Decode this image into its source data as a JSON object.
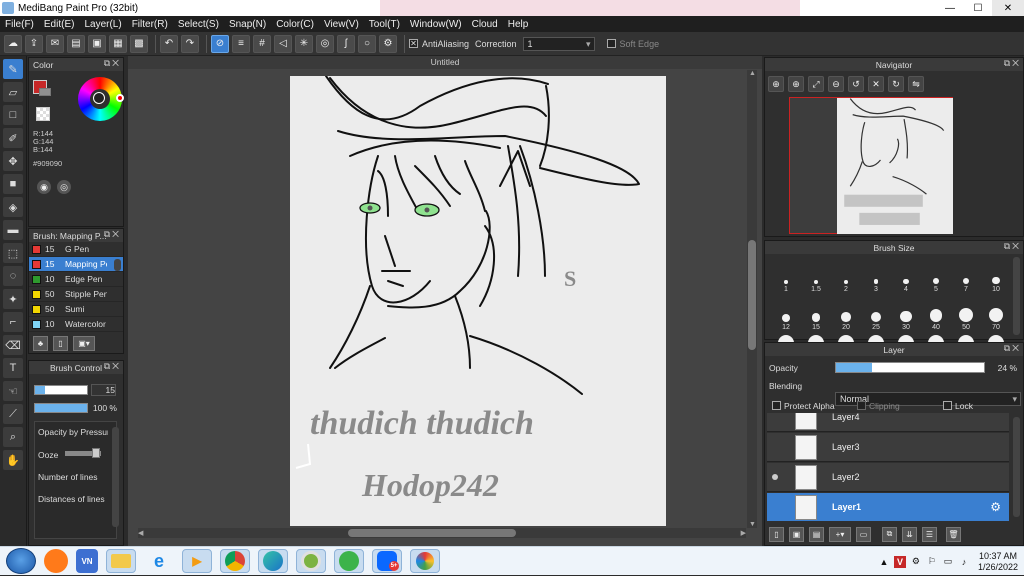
{
  "window": {
    "title": "MediBang Paint Pro (32bit)",
    "controls": [
      "—",
      "☐",
      "✕"
    ]
  },
  "menu": [
    "File(F)",
    "Edit(E)",
    "Layer(L)",
    "Filter(R)",
    "Select(S)",
    "Snap(N)",
    "Color(C)",
    "View(V)",
    "Tool(T)",
    "Window(W)",
    "Cloud",
    "Help"
  ],
  "toolbar": {
    "antialiasing_label": "AntiAliasing",
    "antialiasing_checked": true,
    "correction_label": "Correction",
    "correction_value": "1",
    "soft_edge_label": "Soft Edge",
    "soft_edge_checked": false
  },
  "color_panel": {
    "title": "Color",
    "r": "R:144",
    "g": "G:144",
    "b": "B:144",
    "hex": "#909090",
    "primary_color": "#c62828",
    "secondary_color": "#ffffff"
  },
  "brush_panel": {
    "title": "Brush: Mapping P...",
    "items": [
      {
        "size": "15",
        "name": "G Pen",
        "color": "#e53935"
      },
      {
        "size": "15",
        "name": "Mapping Pen",
        "color": "#e53935",
        "selected": true
      },
      {
        "size": "10",
        "name": "Edge Pen",
        "color": "#2e9a2e"
      },
      {
        "size": "50",
        "name": "Stipple Pen",
        "color": "#f2d600"
      },
      {
        "size": "50",
        "name": "Sumi",
        "color": "#f2d600"
      },
      {
        "size": "10",
        "name": "Watercolor",
        "color": "#7fd4f5"
      }
    ]
  },
  "brush_control": {
    "title": "Brush Control",
    "size_value": "15",
    "size_fraction": 0.2,
    "opacity_value": "100 %",
    "opacity_fraction": 1.0,
    "options": [
      "Opacity by Pressure",
      "Ooze",
      "Number of lines",
      "Distances of lines"
    ]
  },
  "canvas": {
    "tab_title": "Untitled",
    "signature_line1": "thudich thudich",
    "signature_line2": "Hodop242"
  },
  "navigator": {
    "title": "Navigator"
  },
  "brush_size": {
    "title": "Brush Size",
    "sizes": [
      "1",
      "1.5",
      "2",
      "3",
      "4",
      "5",
      "7",
      "10",
      "12",
      "15",
      "20",
      "25",
      "30",
      "40",
      "50",
      "70"
    ]
  },
  "layer_panel": {
    "title": "Layer",
    "opacity_label": "Opacity",
    "opacity_value": "24 %",
    "opacity_fraction": 0.24,
    "blending_label": "Blending",
    "blending_value": "Normal",
    "protect_alpha_label": "Protect Alpha",
    "clipping_label": "Clipping",
    "lock_label": "Lock",
    "layers": [
      {
        "name": "Layer4"
      },
      {
        "name": "Layer3"
      },
      {
        "name": "Layer2",
        "visible_dot": true
      },
      {
        "name": "Layer1",
        "selected": true
      }
    ]
  },
  "taskbar": {
    "time": "10:37 AM",
    "date": "1/26/2022",
    "apps": [
      "firefox",
      "unikey",
      "file-explorer",
      "internet-explorer",
      "media-player",
      "chrome",
      "edge",
      "coc-coc",
      "browser-green",
      "zalo",
      "medibang"
    ]
  }
}
